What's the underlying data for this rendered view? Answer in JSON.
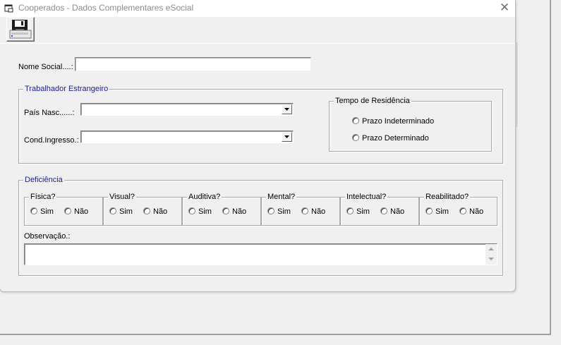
{
  "window": {
    "title": "Cooperados - Dados Complementares eSocial",
    "close_symbol": "✕"
  },
  "toolbar": {
    "save_icon": "floppy-disk-save-icon"
  },
  "form": {
    "nome_social_label": "Nome Social....:",
    "nome_social_value": ""
  },
  "trabalhador_estrangeiro": {
    "title": "Trabalhador Estrangeiro",
    "pais_label": "País Nasc......:",
    "pais_value": "",
    "cond_label": "Cond.Ingresso.:",
    "cond_value": ""
  },
  "tempo_residencia": {
    "title": "Tempo de Residência",
    "options": [
      "Prazo Indeterminado",
      "Prazo Determinado"
    ]
  },
  "deficiencia": {
    "title": "Deficiência",
    "groups": [
      {
        "label": "Física?",
        "yes": "Sim",
        "no": "Não"
      },
      {
        "label": "Visual?",
        "yes": "Sim",
        "no": "Não"
      },
      {
        "label": "Auditiva?",
        "yes": "Sim",
        "no": "Não"
      },
      {
        "label": "Mental?",
        "yes": "Sim",
        "no": "Não"
      },
      {
        "label": "Intelectual?",
        "yes": "Sim",
        "no": "Não"
      },
      {
        "label": "Reabilitado?",
        "yes": "Sim",
        "no": "Não"
      }
    ],
    "observacao_label": "Observação.:",
    "observacao_value": ""
  }
}
